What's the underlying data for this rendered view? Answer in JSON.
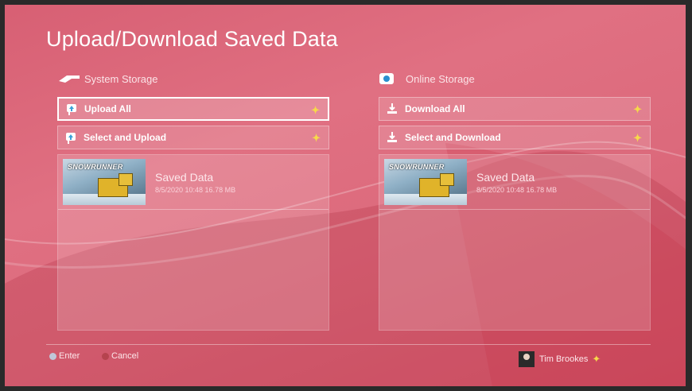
{
  "page": {
    "title": "Upload/Download Saved Data"
  },
  "left_panel": {
    "header": "System Storage",
    "header_icon": "ps4-console-icon",
    "actions": [
      {
        "label": "Upload All",
        "icon": "upload-icon"
      },
      {
        "label": "Select and Upload",
        "icon": "upload-icon"
      }
    ],
    "items": [
      {
        "thumb_logo": "SNOWRUNNER",
        "title": "Saved Data",
        "meta": "8/5/2020  10:48  16.78 MB"
      }
    ]
  },
  "right_panel": {
    "header": "Online Storage",
    "header_icon": "cloud-storage-icon",
    "actions": [
      {
        "label": "Download All",
        "icon": "download-icon"
      },
      {
        "label": "Select and Download",
        "icon": "download-icon"
      }
    ],
    "items": [
      {
        "thumb_logo": "SNOWRUNNER",
        "title": "Saved Data",
        "meta": "8/5/2020  10:48  16.78 MB"
      }
    ]
  },
  "footer": {
    "enter_label": "Enter",
    "cancel_label": "Cancel",
    "user_name": "Tim Brookes"
  },
  "colors": {
    "accent_plus": "#f6d94a",
    "background": "#dc6a7c"
  }
}
